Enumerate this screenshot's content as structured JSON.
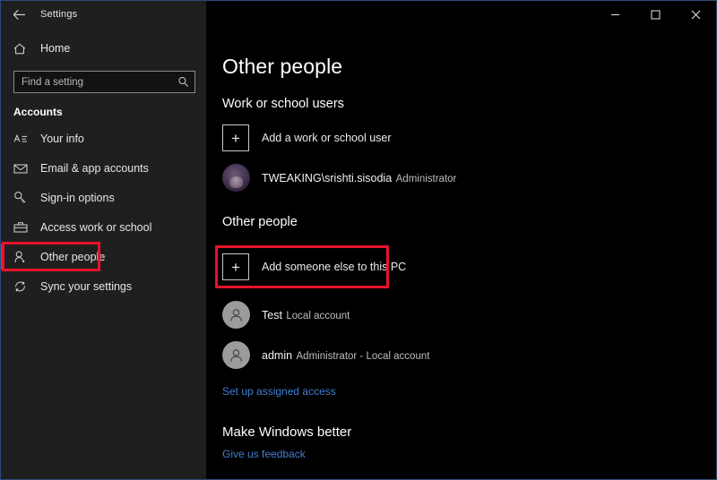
{
  "window": {
    "title": "Settings",
    "back_icon": "back-arrow-icon",
    "controls": {
      "minimize": "minimize-icon",
      "maximize": "maximize-icon",
      "close": "close-icon"
    },
    "accent_color": "#2a6ad4",
    "highlight_color": "#e8132b",
    "link_color": "#3f7fd4"
  },
  "sidebar": {
    "home_label": "Home",
    "home_icon": "home-icon",
    "search": {
      "placeholder": "Find a setting",
      "value": "",
      "icon": "search-icon"
    },
    "section_title": "Accounts",
    "items": [
      {
        "label": "Your info",
        "icon": "your-info-icon",
        "selected": false
      },
      {
        "label": "Email & app accounts",
        "icon": "envelope-icon",
        "selected": false
      },
      {
        "label": "Sign-in options",
        "icon": "key-icon",
        "selected": false
      },
      {
        "label": "Access work or school",
        "icon": "briefcase-icon",
        "selected": false
      },
      {
        "label": "Other people",
        "icon": "person-icon",
        "selected": true
      },
      {
        "label": "Sync your settings",
        "icon": "sync-icon",
        "selected": false
      }
    ]
  },
  "main": {
    "page_title": "Other people",
    "work_section": {
      "title": "Work or school users",
      "add_label": "Add a work or school user",
      "add_icon": "plus-icon",
      "users": [
        {
          "name": "TWEAKING\\srishti.sisodia",
          "role": "Administrator",
          "avatar": "photo-avatar"
        }
      ]
    },
    "other_section": {
      "title": "Other people",
      "add_label": "Add someone else to this PC",
      "add_icon": "plus-icon",
      "users": [
        {
          "name": "Test",
          "role": "Local account",
          "avatar": "generic-avatar"
        },
        {
          "name": "admin",
          "role": "Administrator - Local account",
          "avatar": "generic-avatar"
        }
      ],
      "assigned_access_link": "Set up assigned access"
    },
    "feedback_section": {
      "title": "Make Windows better",
      "link": "Give us feedback"
    }
  }
}
